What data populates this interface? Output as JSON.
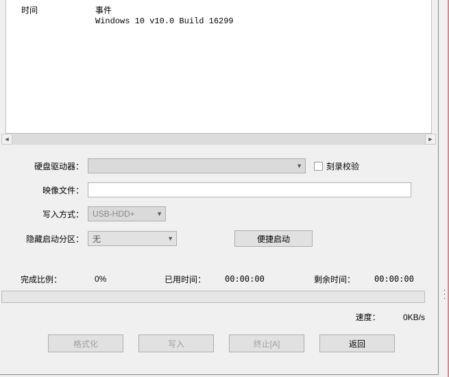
{
  "log": {
    "header_time": "时间",
    "header_event": "事件",
    "line1": "Windows 10 v10.0 Build 16299"
  },
  "form": {
    "hdd_label": "硬盘驱动器：",
    "hdd_value": "",
    "verify_label": "刻录校验",
    "image_label": "映像文件：",
    "image_value": "",
    "write_label": "写入方式：",
    "write_value": "USB-HDD+",
    "hide_label": "隐藏启动分区：",
    "hide_value": "无",
    "quick_btn": "便捷启动"
  },
  "stats": {
    "complete_label": "完成比例：",
    "complete_value": "0%",
    "elapsed_label": "已用时间：",
    "elapsed_value": "00:00:00",
    "remain_label": "剩余时间：",
    "remain_value": "00:00:00",
    "speed_label": "速度：",
    "speed_value": "0KB/s"
  },
  "buttons": {
    "format": "格式化",
    "write": "写入",
    "abort": "终止[A]",
    "back": "返回"
  }
}
